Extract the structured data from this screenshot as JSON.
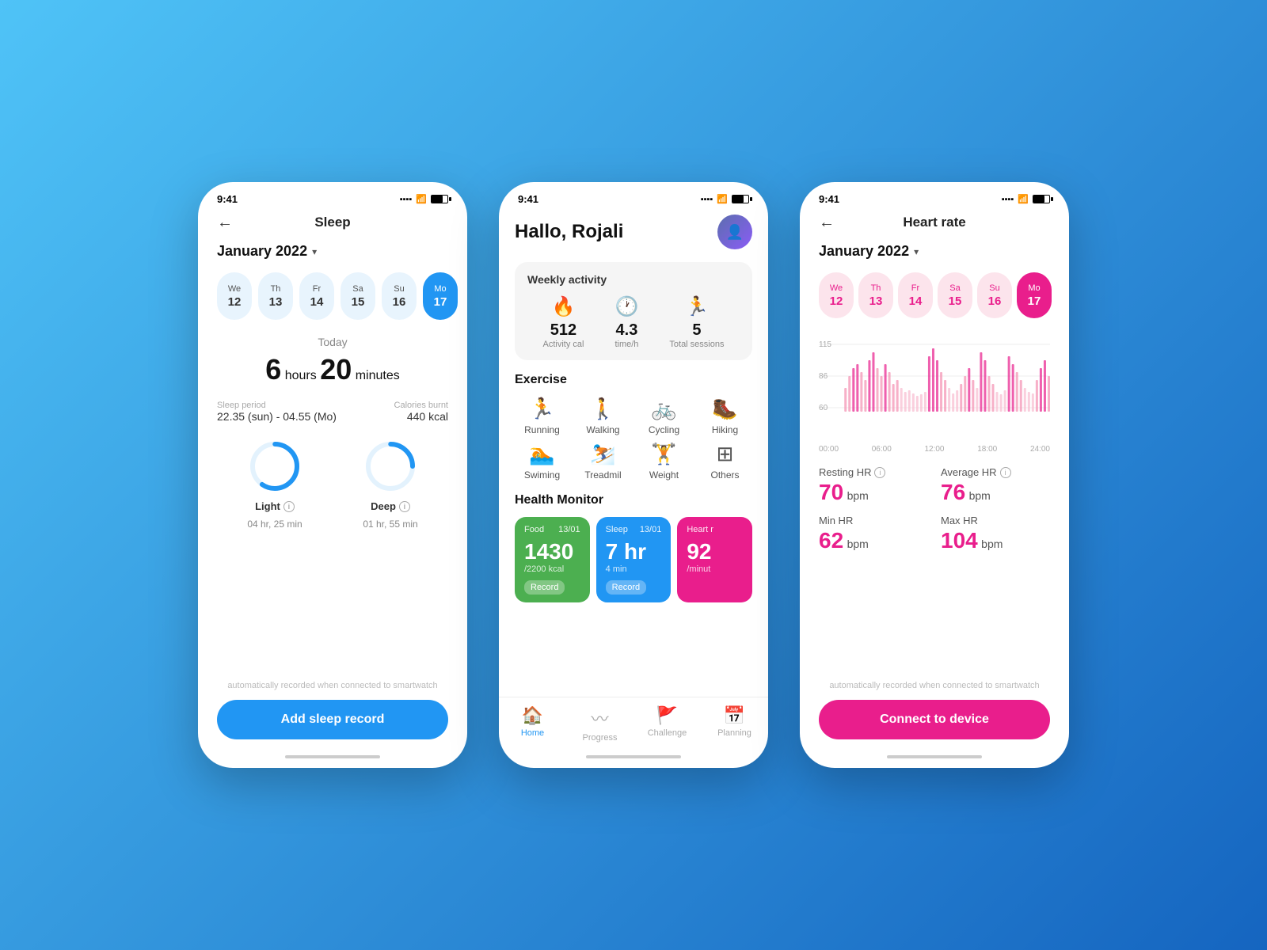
{
  "phone1": {
    "status_time": "9:41",
    "title": "Sleep",
    "month": "January 2022",
    "dates": [
      {
        "day": "We",
        "num": "12"
      },
      {
        "day": "Th",
        "num": "13"
      },
      {
        "day": "Fr",
        "num": "14"
      },
      {
        "day": "Sa",
        "num": "15"
      },
      {
        "day": "Su",
        "num": "16"
      },
      {
        "day": "Mo",
        "num": "17"
      }
    ],
    "today_label": "Today",
    "sleep_hours": "6",
    "sleep_hours_label": "hours",
    "sleep_minutes": "20",
    "sleep_minutes_label": "minutes",
    "sleep_period_label": "Sleep period",
    "sleep_period": "22.35 (sun) - 04.55 (Mo)",
    "calories_burnt_label": "Calories burnt",
    "calories_burnt": "440 kcal",
    "light_label": "Light",
    "light_time": "04 hr, 25 min",
    "deep_label": "Deep",
    "deep_time": "01 hr, 55 min",
    "auto_record": "automatically recorded when connected to smartwatch",
    "cta_label": "Add sleep record"
  },
  "phone2": {
    "status_time": "9:41",
    "greeting": "Hallo, Rojali",
    "weekly_title": "Weekly activity",
    "stats": [
      {
        "icon": "🔥",
        "value": "512",
        "label": "Activity cal"
      },
      {
        "icon": "🕐",
        "value": "4.3",
        "label": "time/h"
      },
      {
        "icon": "🏃",
        "value": "5",
        "label": "Total sessions"
      }
    ],
    "exercise_title": "Exercise",
    "exercises": [
      {
        "icon": "🏃",
        "label": "Running"
      },
      {
        "icon": "🚶",
        "label": "Walking"
      },
      {
        "icon": "🚲",
        "label": "Cycling"
      },
      {
        "icon": "🥾",
        "label": "Hiking"
      },
      {
        "icon": "🏊",
        "label": "Swiming"
      },
      {
        "icon": "⛷️",
        "label": "Treadmil"
      },
      {
        "icon": "🏋️",
        "label": "Weight"
      },
      {
        "icon": "⊞",
        "label": "Others"
      }
    ],
    "health_title": "Health Monitor",
    "health_cards": [
      {
        "bg": "green",
        "tag": "Food",
        "date": "13/01",
        "value": "1430",
        "sub": "/2200 kcal",
        "btn": "Record"
      },
      {
        "bg": "blue",
        "tag": "Sleep",
        "date": "13/01",
        "value": "7 hr",
        "sub": "4 min",
        "btn": "Record"
      },
      {
        "bg": "pink",
        "tag": "Heart r",
        "date": "",
        "value": "92",
        "sub": "/minut",
        "btn": ""
      }
    ],
    "nav_items": [
      {
        "icon": "🏠",
        "label": "Home",
        "active": true
      },
      {
        "icon": "〰",
        "label": "Progress",
        "active": false
      },
      {
        "icon": "🚩",
        "label": "Challenge",
        "active": false
      },
      {
        "icon": "📅",
        "label": "Planning",
        "active": false
      }
    ]
  },
  "phone3": {
    "status_time": "9:41",
    "title": "Heart rate",
    "month": "January 2022",
    "dates": [
      {
        "day": "We",
        "num": "12"
      },
      {
        "day": "Th",
        "num": "13"
      },
      {
        "day": "Fr",
        "num": "14"
      },
      {
        "day": "Sa",
        "num": "15"
      },
      {
        "day": "Su",
        "num": "16"
      },
      {
        "day": "Mo",
        "num": "17"
      }
    ],
    "chart_y_labels": [
      "115",
      "86",
      "60"
    ],
    "time_labels": [
      "00:00",
      "06:00",
      "12:00",
      "18:00",
      "24:00"
    ],
    "resting_hr_label": "Resting HR",
    "resting_hr_value": "70",
    "resting_hr_unit": "bpm",
    "average_hr_label": "Average HR",
    "average_hr_value": "76",
    "average_hr_unit": "bpm",
    "min_hr_label": "Min HR",
    "min_hr_value": "62",
    "min_hr_unit": "bpm",
    "max_hr_label": "Max HR",
    "max_hr_value": "104",
    "max_hr_unit": "bpm",
    "auto_record": "automatically recorded when connected to smartwatch",
    "cta_label": "Connect to device"
  },
  "colors": {
    "blue": "#2196f3",
    "pink": "#e91e8c",
    "green": "#4caf50",
    "light_blue_chip": "#e3f2fd",
    "pink_chip": "#fce4ec"
  }
}
